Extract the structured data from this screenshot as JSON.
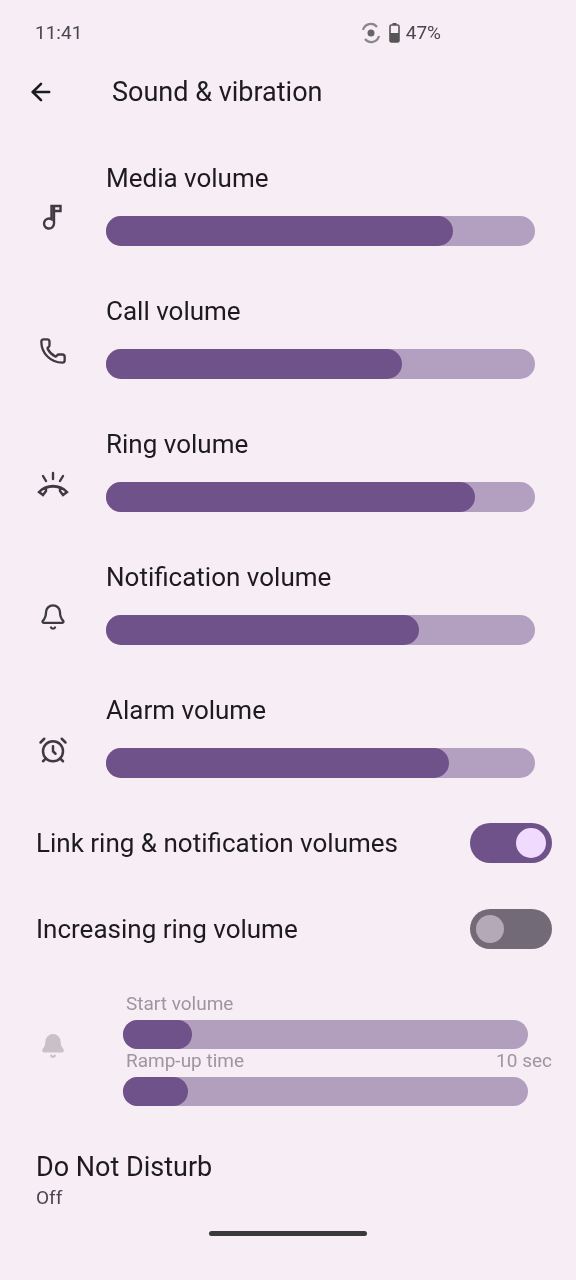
{
  "status_bar": {
    "time": "11:41",
    "battery": "47%"
  },
  "header": {
    "title": "Sound & vibration"
  },
  "volumes": [
    {
      "label": "Media volume",
      "level": 0.81
    },
    {
      "label": "Call volume",
      "level": 0.69
    },
    {
      "label": "Ring volume",
      "level": 0.86
    },
    {
      "label": "Notification volume",
      "level": 0.73
    },
    {
      "label": "Alarm volume",
      "level": 0.8
    }
  ],
  "toggles": [
    {
      "label": "Link ring & notification volumes",
      "on": true
    },
    {
      "label": "Increasing ring volume",
      "on": false
    }
  ],
  "increasing_ring": {
    "disabled": true,
    "sliders": [
      {
        "label": "Start volume",
        "level": 0.17
      },
      {
        "label": "Ramp-up time",
        "reading": "10 sec",
        "level": 0.16
      }
    ]
  },
  "do_not_disturb": {
    "title": "Do Not Disturb",
    "summary": "Off"
  }
}
